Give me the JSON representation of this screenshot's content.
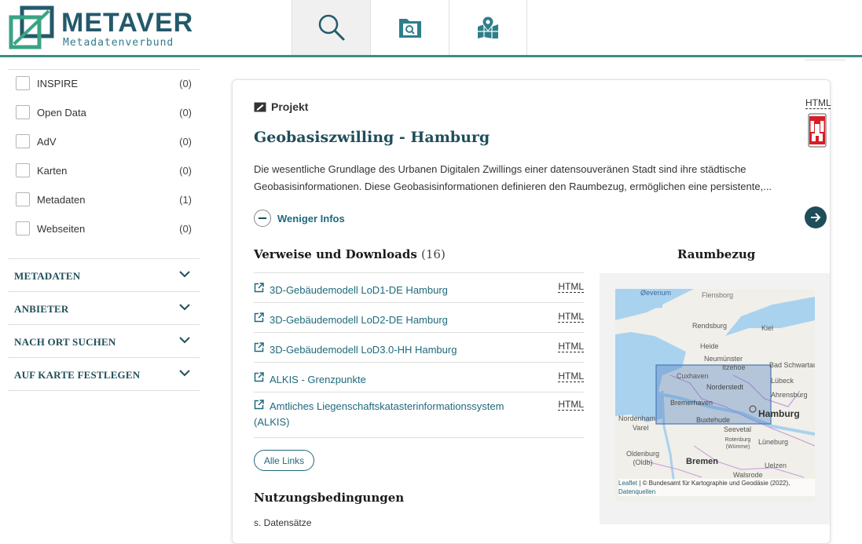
{
  "header": {
    "logo_word": "METAVER",
    "logo_sub": "Metadatenverbund",
    "tabs": [
      {
        "icon": "search-icon",
        "active": true
      },
      {
        "icon": "folder-search-icon",
        "active": false
      },
      {
        "icon": "map-pin-icon",
        "active": false
      }
    ]
  },
  "sidebar": {
    "filters": [
      {
        "label": "INSPIRE",
        "count": "(0)"
      },
      {
        "label": "Open Data",
        "count": "(0)"
      },
      {
        "label": "AdV",
        "count": "(0)"
      },
      {
        "label": "Karten",
        "count": "(0)"
      },
      {
        "label": "Metadaten",
        "count": "(1)"
      },
      {
        "label": "Webseiten",
        "count": "(0)"
      }
    ],
    "accordions": [
      {
        "label": "METADATEN"
      },
      {
        "label": "ANBIETER"
      },
      {
        "label": "NACH ORT SUCHEN"
      },
      {
        "label": "AUF KARTE FESTLEGEN"
      }
    ]
  },
  "result": {
    "type_label": "Projekt",
    "format_top": "HTML",
    "title": "Geobasiszwilling - Hamburg",
    "description": "Die wesentliche Grundlage des Urbanen Digitalen Zwillings einer datensouveränen Stadt sind ihre städtische Geobasisinformationen. Diese Geobasisinformationen definieren den Raumbezug, ermöglichen eine persistente,...",
    "less_info_label": "Weniger Infos",
    "links_title": "Verweise und Downloads",
    "links_count": "(16)",
    "links": [
      {
        "label": "3D-Gebäudemodell LoD1-DE Hamburg",
        "format": "HTML"
      },
      {
        "label": "3D-Gebäudemodell LoD2-DE Hamburg",
        "format": "HTML"
      },
      {
        "label": "3D-Gebäudemodell LoD3.0-HH Hamburg",
        "format": "HTML"
      },
      {
        "label": "ALKIS - Grenzpunkte",
        "format": "HTML"
      },
      {
        "label": "Amtliches Liegenschaftskatasterinformationssystem (ALKIS)",
        "format": "HTML"
      }
    ],
    "all_links_label": "Alle Links",
    "terms_title": "Nutzungsbedingungen",
    "terms_sub": "s. Datensätze",
    "map_title": "Raumbezug",
    "map": {
      "places": [
        "Øevenum",
        "Flensborg",
        "Rendsburg",
        "Kiel",
        "Heide",
        "Neumünster",
        "Itzehoe",
        "Bad Schwartau",
        "Cuxhaven",
        "Lübeck",
        "Norderstedt",
        "Ahrensburg",
        "Bremerhaven",
        "Hamburg",
        "Buxtehude",
        "Nordenham",
        "Varel",
        "Seevetal",
        "Rotenburg (Wümme)",
        "Lüneburg",
        "Oldenburg (Oldb)",
        "Bremen",
        "Uelzen",
        "Walsrode"
      ],
      "attribution_link": "Leaflet",
      "attribution_text": "| © Bundesamt für Kartographie und Geodäsie (2022),",
      "attribution_link2": "Datenquellen"
    }
  }
}
